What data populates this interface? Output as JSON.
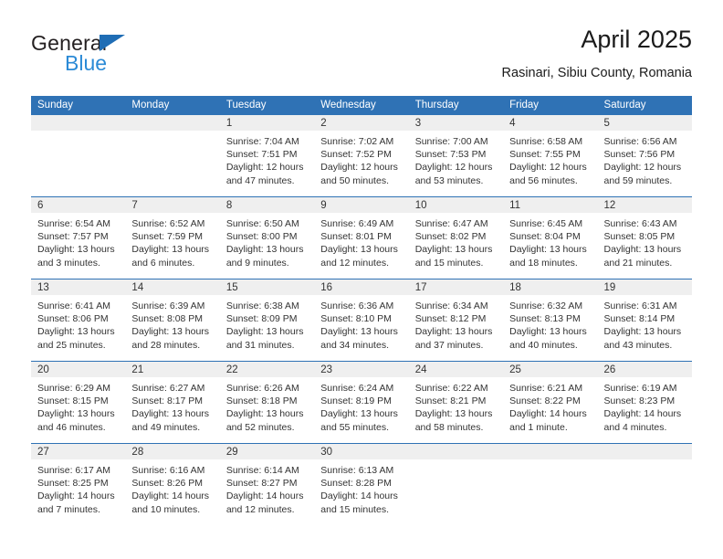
{
  "brand": {
    "name_dark": "General",
    "name_blue": "Blue",
    "accent_blue": "#2f72b5",
    "logo_blue": "#2b8ad6"
  },
  "header": {
    "title": "April 2025",
    "subtitle": "Rasinari, Sibiu County, Romania"
  },
  "calendar": {
    "weekday_headers": [
      "Sunday",
      "Monday",
      "Tuesday",
      "Wednesday",
      "Thursday",
      "Friday",
      "Saturday"
    ],
    "header_bg": "#2f72b5",
    "daynum_bg": "#efefef",
    "weeks": [
      [
        {
          "day": ""
        },
        {
          "day": ""
        },
        {
          "day": "1",
          "sunrise": "Sunrise: 7:04 AM",
          "sunset": "Sunset: 7:51 PM",
          "daylight_1": "Daylight: 12 hours",
          "daylight_2": "and 47 minutes."
        },
        {
          "day": "2",
          "sunrise": "Sunrise: 7:02 AM",
          "sunset": "Sunset: 7:52 PM",
          "daylight_1": "Daylight: 12 hours",
          "daylight_2": "and 50 minutes."
        },
        {
          "day": "3",
          "sunrise": "Sunrise: 7:00 AM",
          "sunset": "Sunset: 7:53 PM",
          "daylight_1": "Daylight: 12 hours",
          "daylight_2": "and 53 minutes."
        },
        {
          "day": "4",
          "sunrise": "Sunrise: 6:58 AM",
          "sunset": "Sunset: 7:55 PM",
          "daylight_1": "Daylight: 12 hours",
          "daylight_2": "and 56 minutes."
        },
        {
          "day": "5",
          "sunrise": "Sunrise: 6:56 AM",
          "sunset": "Sunset: 7:56 PM",
          "daylight_1": "Daylight: 12 hours",
          "daylight_2": "and 59 minutes."
        }
      ],
      [
        {
          "day": "6",
          "sunrise": "Sunrise: 6:54 AM",
          "sunset": "Sunset: 7:57 PM",
          "daylight_1": "Daylight: 13 hours",
          "daylight_2": "and 3 minutes."
        },
        {
          "day": "7",
          "sunrise": "Sunrise: 6:52 AM",
          "sunset": "Sunset: 7:59 PM",
          "daylight_1": "Daylight: 13 hours",
          "daylight_2": "and 6 minutes."
        },
        {
          "day": "8",
          "sunrise": "Sunrise: 6:50 AM",
          "sunset": "Sunset: 8:00 PM",
          "daylight_1": "Daylight: 13 hours",
          "daylight_2": "and 9 minutes."
        },
        {
          "day": "9",
          "sunrise": "Sunrise: 6:49 AM",
          "sunset": "Sunset: 8:01 PM",
          "daylight_1": "Daylight: 13 hours",
          "daylight_2": "and 12 minutes."
        },
        {
          "day": "10",
          "sunrise": "Sunrise: 6:47 AM",
          "sunset": "Sunset: 8:02 PM",
          "daylight_1": "Daylight: 13 hours",
          "daylight_2": "and 15 minutes."
        },
        {
          "day": "11",
          "sunrise": "Sunrise: 6:45 AM",
          "sunset": "Sunset: 8:04 PM",
          "daylight_1": "Daylight: 13 hours",
          "daylight_2": "and 18 minutes."
        },
        {
          "day": "12",
          "sunrise": "Sunrise: 6:43 AM",
          "sunset": "Sunset: 8:05 PM",
          "daylight_1": "Daylight: 13 hours",
          "daylight_2": "and 21 minutes."
        }
      ],
      [
        {
          "day": "13",
          "sunrise": "Sunrise: 6:41 AM",
          "sunset": "Sunset: 8:06 PM",
          "daylight_1": "Daylight: 13 hours",
          "daylight_2": "and 25 minutes."
        },
        {
          "day": "14",
          "sunrise": "Sunrise: 6:39 AM",
          "sunset": "Sunset: 8:08 PM",
          "daylight_1": "Daylight: 13 hours",
          "daylight_2": "and 28 minutes."
        },
        {
          "day": "15",
          "sunrise": "Sunrise: 6:38 AM",
          "sunset": "Sunset: 8:09 PM",
          "daylight_1": "Daylight: 13 hours",
          "daylight_2": "and 31 minutes."
        },
        {
          "day": "16",
          "sunrise": "Sunrise: 6:36 AM",
          "sunset": "Sunset: 8:10 PM",
          "daylight_1": "Daylight: 13 hours",
          "daylight_2": "and 34 minutes."
        },
        {
          "day": "17",
          "sunrise": "Sunrise: 6:34 AM",
          "sunset": "Sunset: 8:12 PM",
          "daylight_1": "Daylight: 13 hours",
          "daylight_2": "and 37 minutes."
        },
        {
          "day": "18",
          "sunrise": "Sunrise: 6:32 AM",
          "sunset": "Sunset: 8:13 PM",
          "daylight_1": "Daylight: 13 hours",
          "daylight_2": "and 40 minutes."
        },
        {
          "day": "19",
          "sunrise": "Sunrise: 6:31 AM",
          "sunset": "Sunset: 8:14 PM",
          "daylight_1": "Daylight: 13 hours",
          "daylight_2": "and 43 minutes."
        }
      ],
      [
        {
          "day": "20",
          "sunrise": "Sunrise: 6:29 AM",
          "sunset": "Sunset: 8:15 PM",
          "daylight_1": "Daylight: 13 hours",
          "daylight_2": "and 46 minutes."
        },
        {
          "day": "21",
          "sunrise": "Sunrise: 6:27 AM",
          "sunset": "Sunset: 8:17 PM",
          "daylight_1": "Daylight: 13 hours",
          "daylight_2": "and 49 minutes."
        },
        {
          "day": "22",
          "sunrise": "Sunrise: 6:26 AM",
          "sunset": "Sunset: 8:18 PM",
          "daylight_1": "Daylight: 13 hours",
          "daylight_2": "and 52 minutes."
        },
        {
          "day": "23",
          "sunrise": "Sunrise: 6:24 AM",
          "sunset": "Sunset: 8:19 PM",
          "daylight_1": "Daylight: 13 hours",
          "daylight_2": "and 55 minutes."
        },
        {
          "day": "24",
          "sunrise": "Sunrise: 6:22 AM",
          "sunset": "Sunset: 8:21 PM",
          "daylight_1": "Daylight: 13 hours",
          "daylight_2": "and 58 minutes."
        },
        {
          "day": "25",
          "sunrise": "Sunrise: 6:21 AM",
          "sunset": "Sunset: 8:22 PM",
          "daylight_1": "Daylight: 14 hours",
          "daylight_2": "and 1 minute."
        },
        {
          "day": "26",
          "sunrise": "Sunrise: 6:19 AM",
          "sunset": "Sunset: 8:23 PM",
          "daylight_1": "Daylight: 14 hours",
          "daylight_2": "and 4 minutes."
        }
      ],
      [
        {
          "day": "27",
          "sunrise": "Sunrise: 6:17 AM",
          "sunset": "Sunset: 8:25 PM",
          "daylight_1": "Daylight: 14 hours",
          "daylight_2": "and 7 minutes."
        },
        {
          "day": "28",
          "sunrise": "Sunrise: 6:16 AM",
          "sunset": "Sunset: 8:26 PM",
          "daylight_1": "Daylight: 14 hours",
          "daylight_2": "and 10 minutes."
        },
        {
          "day": "29",
          "sunrise": "Sunrise: 6:14 AM",
          "sunset": "Sunset: 8:27 PM",
          "daylight_1": "Daylight: 14 hours",
          "daylight_2": "and 12 minutes."
        },
        {
          "day": "30",
          "sunrise": "Sunrise: 6:13 AM",
          "sunset": "Sunset: 8:28 PM",
          "daylight_1": "Daylight: 14 hours",
          "daylight_2": "and 15 minutes."
        },
        {
          "day": ""
        },
        {
          "day": ""
        },
        {
          "day": ""
        }
      ]
    ]
  }
}
